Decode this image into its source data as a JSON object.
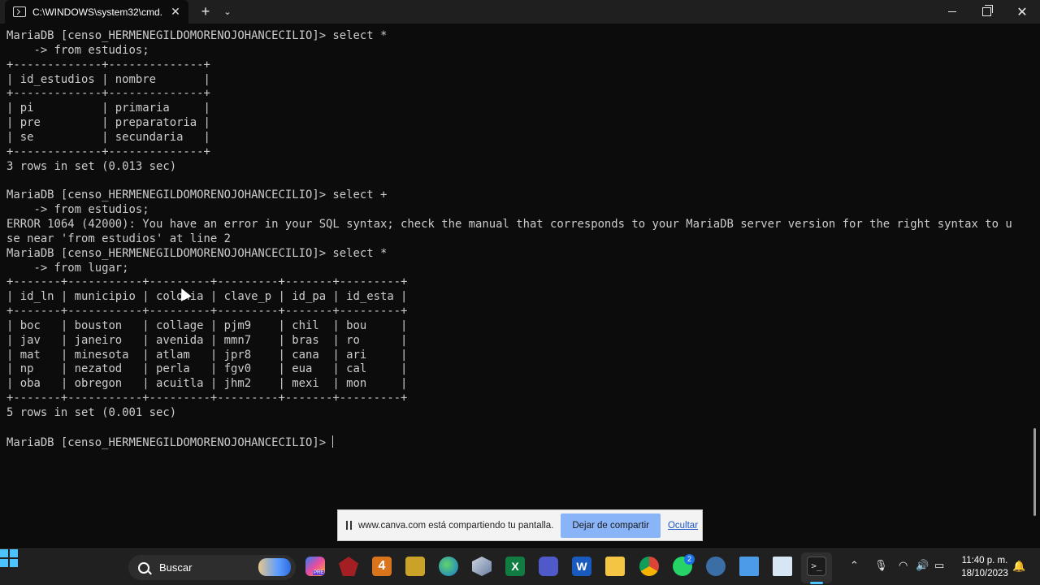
{
  "window": {
    "tab_title": "C:\\WINDOWS\\system32\\cmd.",
    "tab_close": "✕",
    "new_tab": "+",
    "dropdown": "⌄",
    "close": "✕"
  },
  "terminal": {
    "lines": [
      "MariaDB [censo_HERMENEGILDOMORENOJOHANCECILIO]> select *",
      "    -> from estudios;",
      "+-------------+--------------+",
      "| id_estudios | nombre       |",
      "+-------------+--------------+",
      "| pi          | primaria     |",
      "| pre         | preparatoria |",
      "| se          | secundaria   |",
      "+-------------+--------------+",
      "3 rows in set (0.013 sec)",
      "",
      "MariaDB [censo_HERMENEGILDOMORENOJOHANCECILIO]> select +",
      "    -> from estudios;",
      "ERROR 1064 (42000): You have an error in your SQL syntax; check the manual that corresponds to your MariaDB server version for the right syntax to u",
      "se near 'from estudios' at line 2",
      "MariaDB [censo_HERMENEGILDOMORENOJOHANCECILIO]> select *",
      "    -> from lugar;",
      "+-------+-----------+---------+---------+-------+---------+",
      "| id_ln | municipio | colonia | clave_p | id_pa | id_esta |",
      "+-------+-----------+---------+---------+-------+---------+",
      "| boc   | bouston   | collage | pjm9    | chil  | bou     |",
      "| jav   | janeiro   | avenida | mmn7    | bras  | ro      |",
      "| mat   | minesota  | atlam   | jpr8    | cana  | ari     |",
      "| np    | nezatod   | perla   | fgv0    | eua   | cal     |",
      "| oba   | obregon   | acuitla | jhm2    | mexi  | mon     |",
      "+-------+-----------+---------+---------+-------+---------+",
      "5 rows in set (0.001 sec)",
      ""
    ],
    "prompt": "MariaDB [censo_HERMENEGILDOMORENOJOHANCECILIO]> "
  },
  "sharebar": {
    "message": "www.canva.com está compartiendo tu pantalla.",
    "stop_label": "Dejar de compartir",
    "hide_label": "Ocultar"
  },
  "taskbar": {
    "search_label": "Buscar",
    "pre_tag": "PRE",
    "four_label": "4",
    "excel_label": "X",
    "word_label": "W",
    "terminal_label": ">_",
    "whatsapp_badge": "2",
    "time": "11:40 p. m.",
    "date": "18/10/2023",
    "icons": [
      "start-icon",
      "copilot-icon",
      "game-icon",
      "four-app-icon",
      "yellow-app-icon",
      "edge-icon",
      "cube-icon",
      "excel-icon",
      "teams-icon",
      "word-icon",
      "file-explorer-icon",
      "chrome-icon",
      "whatsapp-icon",
      "bug-icon",
      "monitor-icon",
      "chart-icon",
      "terminal-icon"
    ]
  },
  "tray": {
    "chevron": "⌃",
    "mic": "🎙",
    "wifi": "◠",
    "volume": "🔊",
    "battery": "▭",
    "bell": "🔔"
  },
  "colors": {
    "terminal_bg": "#0c0c0c",
    "terminal_fg": "#cccccc",
    "titlebar": "#1f1f1f",
    "taskbar": "#202020",
    "accent": "#4cc2ff",
    "share_button": "#8ab4f8"
  }
}
